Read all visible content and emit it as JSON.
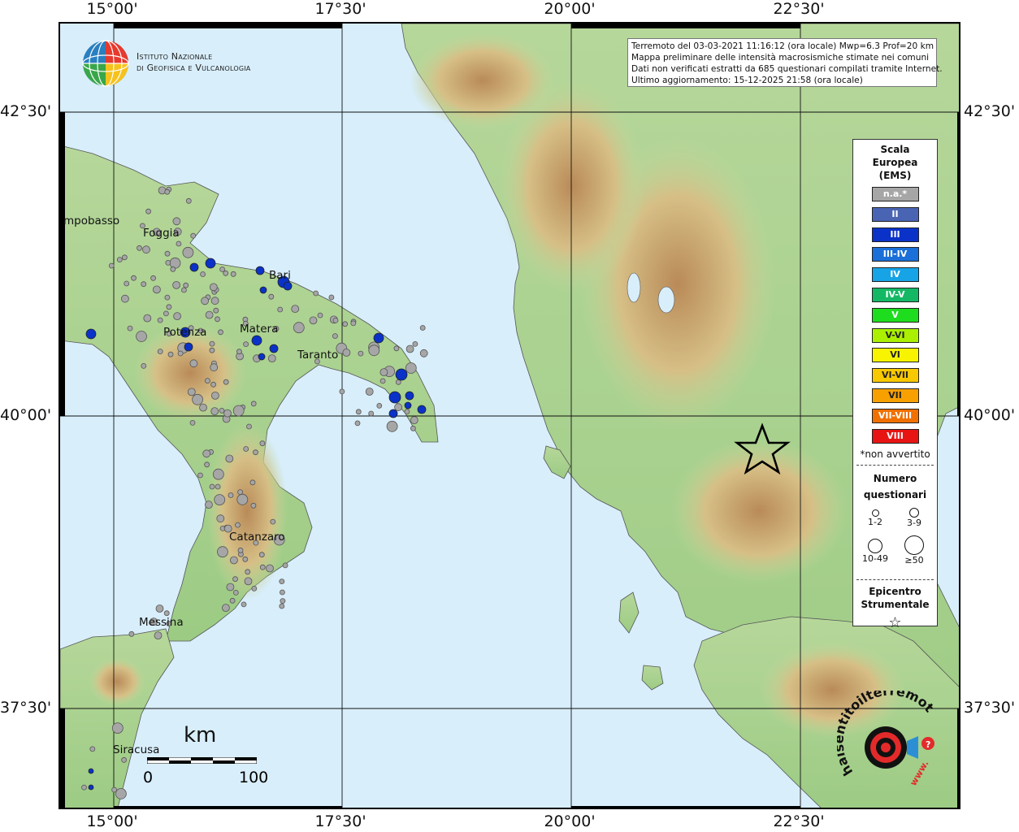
{
  "map": {
    "lon_ticks": [
      "15°00'",
      "17°30'",
      "20°00'",
      "22°30'"
    ],
    "lat_ticks": [
      "42°30'",
      "40°00'",
      "37°30'"
    ],
    "colors": {
      "sea": "#d8eefb",
      "land_low": "#a9d18e",
      "land_mid": "#d6c98d",
      "land_high": "#c9a36b",
      "grid": "#111111"
    }
  },
  "logo": {
    "org_line1": "Istituto Nazionale",
    "org_line2": "di Geofisica e Vulcanologia"
  },
  "info": {
    "line1": "Terremoto del 03-03-2021 11:16:12 (ora locale) Mwp=6.3 Prof=20 km",
    "line2": "Mappa preliminare delle intensità macrosismiche stimate nei comuni",
    "line3": "Dati non verificati estratti da 685 questionari compilati tramite Internet.",
    "line4": "Ultimo aggiornamento: 15-12-2025 21:58 (ora locale)"
  },
  "legend": {
    "title_line1": "Scala",
    "title_line2": "Europea",
    "title_line3": "(EMS)",
    "classes": [
      {
        "label": "n.a.*",
        "color": "#a6a6a6"
      },
      {
        "label": "II",
        "color": "#4a64b4"
      },
      {
        "label": "III",
        "color": "#0a32c8"
      },
      {
        "label": "III-IV",
        "color": "#1a6fd8"
      },
      {
        "label": "IV",
        "color": "#16a4e6"
      },
      {
        "label": "IV-V",
        "color": "#14b864"
      },
      {
        "label": "V",
        "color": "#1edc1e"
      },
      {
        "label": "V-VI",
        "color": "#aaf000"
      },
      {
        "label": "VI",
        "color": "#f8f400"
      },
      {
        "label": "VI-VII",
        "color": "#f8c800"
      },
      {
        "label": "VII",
        "color": "#f8a000"
      },
      {
        "label": "VII-VIII",
        "color": "#f07000"
      },
      {
        "label": "VIII",
        "color": "#e81414"
      }
    ],
    "note": "*non avvertito",
    "count_title_line1": "Numero",
    "count_title_line2": "questionari",
    "size_labels": [
      "1-2",
      "3-9",
      "10-49",
      "≥50"
    ],
    "epicenter_line1": "Epicentro",
    "epicenter_line2": "Strumentale"
  },
  "cities": [
    "mpobasso",
    "Foggia",
    "Bari",
    "Potenza",
    "Matera",
    "Taranto",
    "Catanzaro",
    "Messina",
    "Siracusa"
  ],
  "scale_bar": {
    "unit": "km",
    "start": "0",
    "end": "100"
  },
  "badge": {
    "text": "haisentitoilterremoto.it",
    "url_text": "www."
  }
}
